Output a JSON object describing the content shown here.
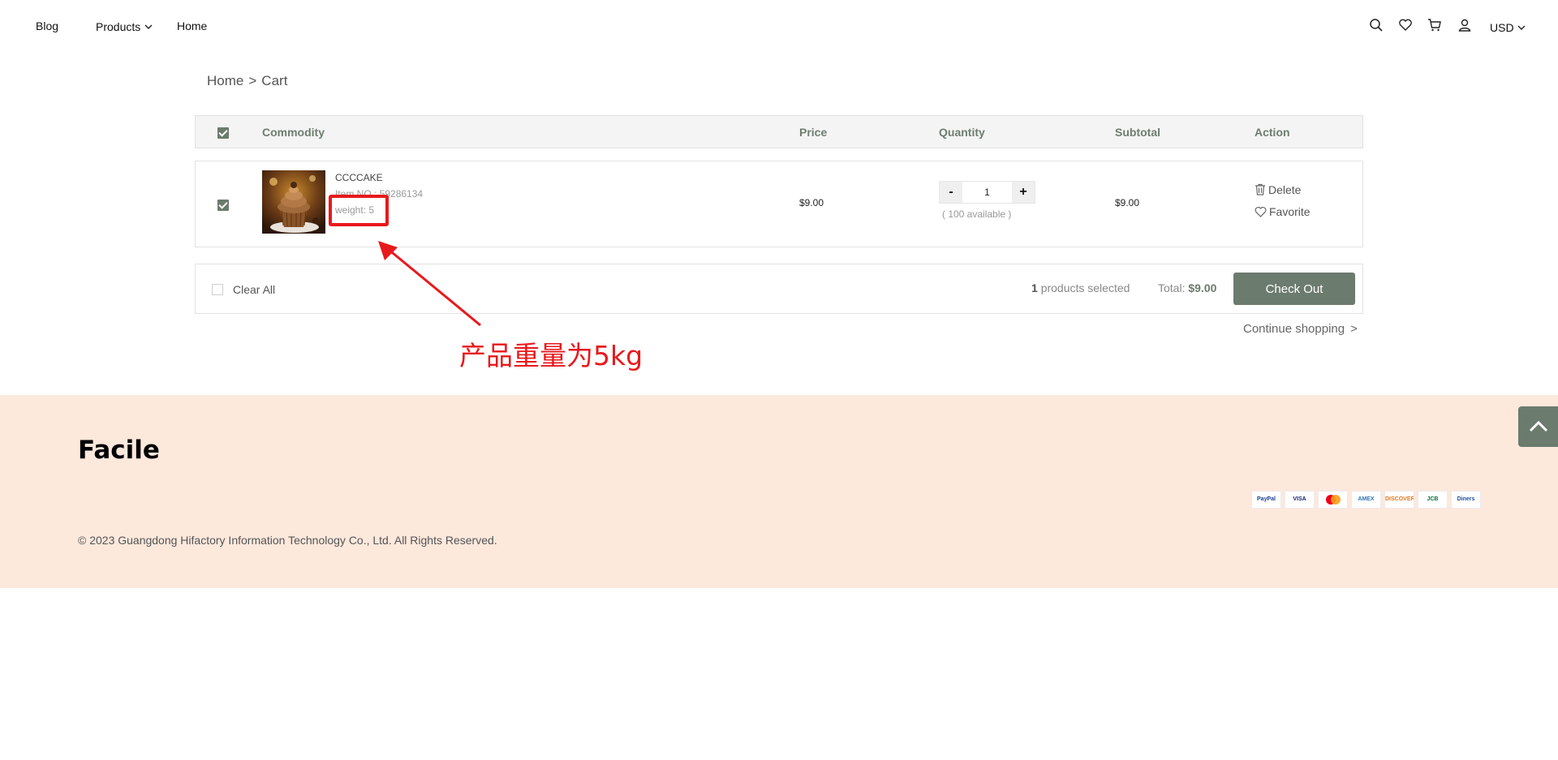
{
  "header": {
    "nav": {
      "blog": "Blog",
      "products": "Products",
      "home": "Home"
    },
    "currency": "USD",
    "icons": [
      "search-icon",
      "heart-icon",
      "cart-icon",
      "user-icon"
    ]
  },
  "breadcrumb": {
    "home": "Home",
    "separator": ">",
    "current": "Cart"
  },
  "cart_table": {
    "columns": {
      "commodity": "Commodity",
      "price": "Price",
      "quantity": "Quantity",
      "subtotal": "Subtotal",
      "action": "Action"
    },
    "select_all_checked": true,
    "items": [
      {
        "checked": true,
        "name": "CCCCAKE",
        "item_no": "Item NO.: 59286134",
        "weight": "weight: 5",
        "price": "$9.00",
        "quantity": "1",
        "qty_minus": "-",
        "qty_plus": "+",
        "available": "( 100 available )",
        "subtotal": "$9.00",
        "delete_label": "Delete",
        "favorite_label": "Favorite"
      }
    ]
  },
  "summary": {
    "clear_all": "Clear All",
    "selected_count": "1",
    "selected_suffix": "products selected",
    "total_label": "Total:",
    "total_value": "$9.00",
    "checkout": "Check Out"
  },
  "continue_shopping": {
    "label": "Continue shopping",
    "arrow": ">"
  },
  "annotation": {
    "text": "产品重量为5kg",
    "color": "#e8191c"
  },
  "footer": {
    "brand": "Facile",
    "copyright": "© 2023 Guangdong Hifactory Information Technology Co., Ltd. All Rights Reserved.",
    "payment_methods": [
      {
        "label": "PayPal",
        "color": "#1d3f8f"
      },
      {
        "label": "VISA",
        "color": "#1a1f71"
      },
      {
        "label": "",
        "color": "#eb001b"
      },
      {
        "label": "AMEX",
        "color": "#2e77bb"
      },
      {
        "label": "DISCOVER",
        "color": "#e2791f"
      },
      {
        "label": "JCB",
        "color": "#0b6f3f"
      },
      {
        "label": "Diners",
        "color": "#1d4e9a"
      }
    ]
  },
  "colors": {
    "accent": "#6b7b6d",
    "footer_bg": "#fde8dc",
    "annotation": "#e8191c"
  }
}
